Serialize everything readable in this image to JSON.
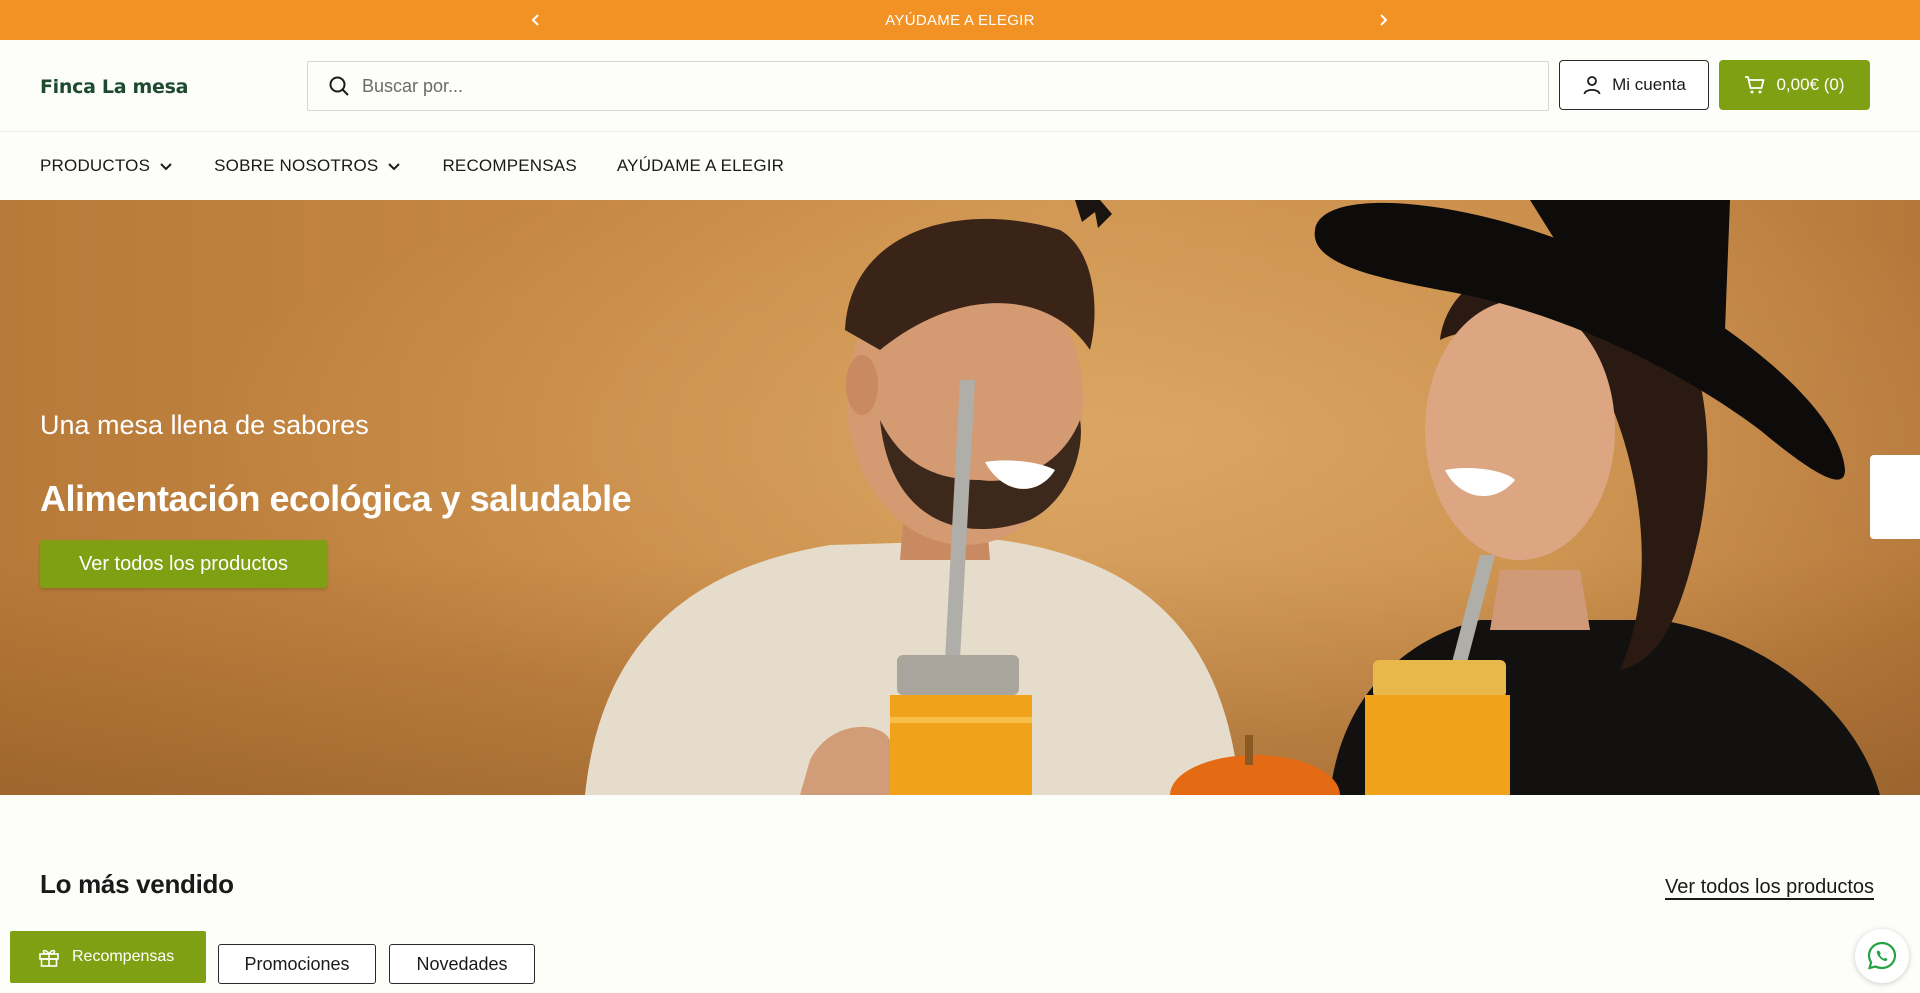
{
  "announcement": {
    "text": "AYÚDAME A ELEGIR"
  },
  "header": {
    "logo_text": "Finca La mesa",
    "search_placeholder": "Buscar por...",
    "account_label": "Mi cuenta",
    "cart_label": "0,00€ (0)"
  },
  "nav": {
    "items": [
      {
        "label": "PRODUCTOS",
        "has_dropdown": true
      },
      {
        "label": "SOBRE NOSOTROS",
        "has_dropdown": true
      },
      {
        "label": "RECOMPENSAS",
        "has_dropdown": false
      },
      {
        "label": "AYÚDAME A ELEGIR",
        "has_dropdown": false
      }
    ]
  },
  "hero": {
    "subtitle": "Una mesa llena de sabores",
    "title": "Alimentación ecológica y saludable",
    "cta_label": "Ver todos los productos"
  },
  "bestsellers": {
    "title": "Lo más vendido",
    "view_all_label": "Ver todos los productos",
    "tabs": [
      {
        "label": "Promociones"
      },
      {
        "label": "Novedades"
      }
    ]
  },
  "rewards_widget": {
    "label": "Recompensas"
  },
  "colors": {
    "announcement_bg": "#f39224",
    "brand_green": "#80a014",
    "logo_green": "#1d4a2e"
  },
  "icons": [
    "chevron-left-icon",
    "chevron-right-icon",
    "search-icon",
    "user-icon",
    "cart-icon",
    "chevron-down-icon",
    "gift-icon",
    "whatsapp-icon"
  ]
}
